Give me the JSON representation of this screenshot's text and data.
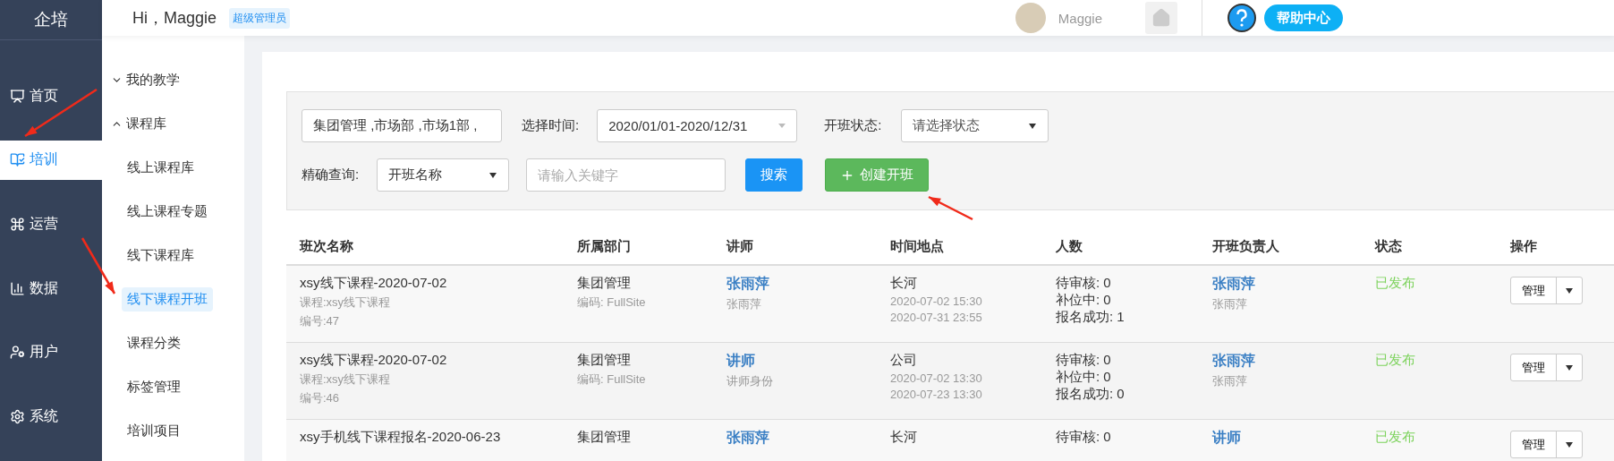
{
  "brand": "企培",
  "header": {
    "greeting": "Hi，Maggie",
    "role_badge": "超级管理员",
    "user_name": "Maggie",
    "help_button": "帮助中心"
  },
  "main_nav": [
    {
      "label": "首页",
      "selected": false
    },
    {
      "label": "培训",
      "selected": true
    },
    {
      "label": "运营",
      "selected": false
    },
    {
      "label": "数据",
      "selected": false
    },
    {
      "label": "用户",
      "selected": false
    },
    {
      "label": "系统",
      "selected": false
    }
  ],
  "sub_nav": [
    {
      "label": "我的教学",
      "kind": "group",
      "expanded": false
    },
    {
      "label": "课程库",
      "kind": "group",
      "expanded": true
    },
    {
      "label": "线上课程库",
      "kind": "link",
      "selected": false
    },
    {
      "label": "线上课程专题",
      "kind": "link",
      "selected": false
    },
    {
      "label": "线下课程库",
      "kind": "link",
      "selected": false
    },
    {
      "label": "线下课程开班",
      "kind": "link",
      "selected": true
    },
    {
      "label": "课程分类",
      "kind": "link",
      "selected": false
    },
    {
      "label": "标签管理",
      "kind": "link",
      "selected": false
    },
    {
      "label": "培训项目",
      "kind": "link",
      "selected": false
    }
  ],
  "filters": {
    "department_value": "集团管理 ,市场部 ,市场1部 ,",
    "time_label": "选择时间:",
    "time_value": "2020/01/01-2020/12/31",
    "status_label": "开班状态:",
    "status_placeholder": "请选择状态",
    "exact_label": "精确查询:",
    "exact_value": "开班名称",
    "keyword_placeholder": "请输入关键字",
    "search_button": "搜索",
    "create_button": "创建开班"
  },
  "table": {
    "columns": [
      "班次名称",
      "所属部门",
      "讲师",
      "时间地点",
      "人数",
      "开班负责人",
      "状态",
      "操作"
    ],
    "rows": [
      {
        "name": "xsy线下课程-2020-07-02",
        "course": "课程:xsy线下课程",
        "number": "编号:47",
        "dept": "集团管理",
        "dept_code": "编码: FullSite",
        "teacher": "张雨萍",
        "teacher_sub": "张雨萍",
        "place": "长河",
        "start": "2020-07-02 15:30",
        "end": "2020-07-31 23:55",
        "counts": [
          "待审核: 0",
          "补位中: 0",
          "报名成功: 1"
        ],
        "owner": "张雨萍",
        "owner_sub": "张雨萍",
        "status": "已发布",
        "action": "管理"
      },
      {
        "name": "xsy线下课程-2020-07-02",
        "course": "课程:xsy线下课程",
        "number": "编号:46",
        "dept": "集团管理",
        "dept_code": "编码: FullSite",
        "teacher": "讲师",
        "teacher_sub": "讲师身份",
        "place": "公司",
        "start": "2020-07-02 13:30",
        "end": "2020-07-23 13:30",
        "counts": [
          "待审核: 0",
          "补位中: 0",
          "报名成功: 0"
        ],
        "owner": "张雨萍",
        "owner_sub": "张雨萍",
        "status": "已发布",
        "action": "管理"
      },
      {
        "name": "xsy手机线下课程报名-2020-06-23",
        "dept": "集团管理",
        "teacher": "张雨萍",
        "place": "长河",
        "counts": [
          "待审核: 0"
        ],
        "owner": "讲师",
        "status": "已发布",
        "action": "管理"
      }
    ]
  }
}
